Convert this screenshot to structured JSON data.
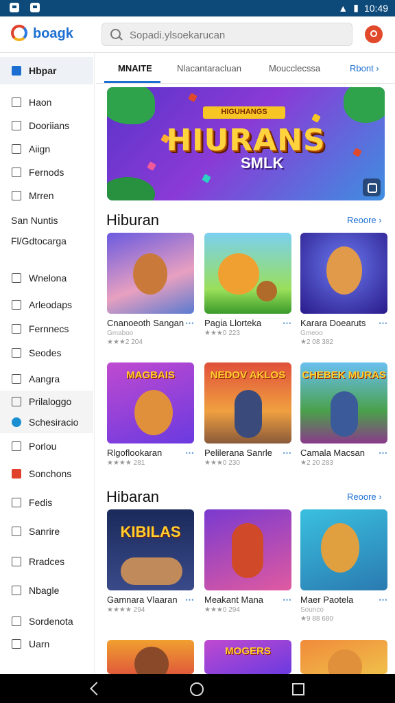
{
  "status_bar": {
    "time": "10:49"
  },
  "header": {
    "brand": "boagk",
    "search_placeholder": "Sopadi.ylsoekarucan"
  },
  "sidebar": {
    "items": [
      {
        "label": "Hbpar"
      },
      {
        "label": "Haon"
      },
      {
        "label": "Dooriians"
      },
      {
        "label": "Aiign"
      },
      {
        "label": "Fernods"
      },
      {
        "label": "Mrren"
      },
      {
        "label": "San Nuntis"
      },
      {
        "label": "Fl/Gdtocarga"
      },
      {
        "label": "Wnelona"
      },
      {
        "label": "Arleodaps"
      },
      {
        "label": "Fernnecs"
      },
      {
        "label": "Seodes"
      },
      {
        "label": "Aangra"
      },
      {
        "label": "Prilaloggo"
      },
      {
        "label": "Schesiracio"
      },
      {
        "label": "Porlou"
      },
      {
        "label": "Sonchons"
      },
      {
        "label": "Fedis"
      },
      {
        "label": "Sanrire"
      },
      {
        "label": "Rradces"
      },
      {
        "label": "Nbagle"
      },
      {
        "label": "Sordenota"
      },
      {
        "label": "Uarn"
      }
    ]
  },
  "tabs": [
    {
      "label": "MNAITE"
    },
    {
      "label": "Nlacantaracluan"
    },
    {
      "label": "Moucclecssa"
    },
    {
      "label": "Rbont"
    }
  ],
  "banner": {
    "ribbon": "HIGUHANGS",
    "title": "HIURANS",
    "subtitle": "SMLK"
  },
  "sections": [
    {
      "title": "Hiburan",
      "more": "Reoore",
      "cards": [
        {
          "name": "Cnanoeoth Sangan",
          "dev": "Gmaboo",
          "rating": "★★★2 204"
        },
        {
          "name": "Pagia Llorteka",
          "dev": "",
          "rating": "★★★0 223"
        },
        {
          "name": "Karara Doearuts",
          "dev": "Gmeoo",
          "rating": "★2 08 382"
        }
      ]
    },
    {
      "title": "",
      "more": "",
      "cards": [
        {
          "name": "Rlgoflookaran",
          "thumb_text": "MAGBAIS",
          "dev": "",
          "rating": "★★★★ 281"
        },
        {
          "name": "Pelilerana Sanrle",
          "thumb_text": "NEDOV AKLOS",
          "dev": "",
          "rating": "★★★0 230"
        },
        {
          "name": "Camala Macsan",
          "thumb_text": "CHEBEK MURAS",
          "dev": "",
          "rating": "★2 20 283"
        }
      ]
    },
    {
      "title": "Hibaran",
      "more": "Reoore",
      "cards": [
        {
          "name": "Gamnara Vlaaran",
          "thumb_text": "KIBILAS",
          "dev": "",
          "rating": "★★★★ 294"
        },
        {
          "name": "Meakant Mana",
          "dev": "",
          "rating": "★★★0 294"
        },
        {
          "name": "Maer Paotela",
          "dev": "Sounco",
          "rating": "★9 88 680"
        }
      ]
    },
    {
      "title": "",
      "more": "",
      "cards": [
        {
          "name": "",
          "dev": "",
          "rating": ""
        },
        {
          "name": "",
          "thumb_text": "MOGERS",
          "dev": "",
          "rating": ""
        },
        {
          "name": "",
          "dev": "",
          "rating": ""
        }
      ]
    }
  ]
}
